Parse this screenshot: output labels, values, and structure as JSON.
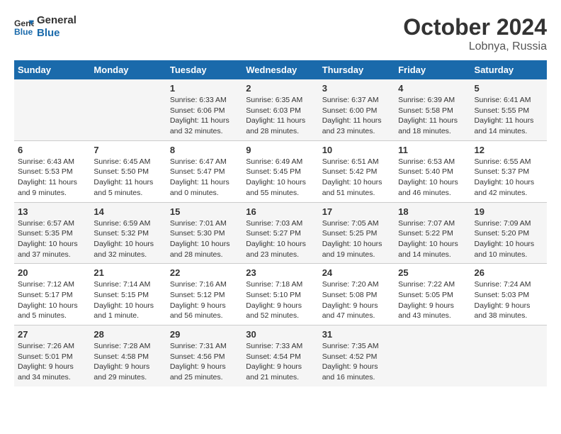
{
  "header": {
    "logo_line1": "General",
    "logo_line2": "Blue",
    "month": "October 2024",
    "location": "Lobnya, Russia"
  },
  "weekdays": [
    "Sunday",
    "Monday",
    "Tuesday",
    "Wednesday",
    "Thursday",
    "Friday",
    "Saturday"
  ],
  "weeks": [
    [
      {
        "day": "",
        "info": ""
      },
      {
        "day": "",
        "info": ""
      },
      {
        "day": "1",
        "info": "Sunrise: 6:33 AM\nSunset: 6:06 PM\nDaylight: 11 hours and 32 minutes."
      },
      {
        "day": "2",
        "info": "Sunrise: 6:35 AM\nSunset: 6:03 PM\nDaylight: 11 hours and 28 minutes."
      },
      {
        "day": "3",
        "info": "Sunrise: 6:37 AM\nSunset: 6:00 PM\nDaylight: 11 hours and 23 minutes."
      },
      {
        "day": "4",
        "info": "Sunrise: 6:39 AM\nSunset: 5:58 PM\nDaylight: 11 hours and 18 minutes."
      },
      {
        "day": "5",
        "info": "Sunrise: 6:41 AM\nSunset: 5:55 PM\nDaylight: 11 hours and 14 minutes."
      }
    ],
    [
      {
        "day": "6",
        "info": "Sunrise: 6:43 AM\nSunset: 5:53 PM\nDaylight: 11 hours and 9 minutes."
      },
      {
        "day": "7",
        "info": "Sunrise: 6:45 AM\nSunset: 5:50 PM\nDaylight: 11 hours and 5 minutes."
      },
      {
        "day": "8",
        "info": "Sunrise: 6:47 AM\nSunset: 5:47 PM\nDaylight: 11 hours and 0 minutes."
      },
      {
        "day": "9",
        "info": "Sunrise: 6:49 AM\nSunset: 5:45 PM\nDaylight: 10 hours and 55 minutes."
      },
      {
        "day": "10",
        "info": "Sunrise: 6:51 AM\nSunset: 5:42 PM\nDaylight: 10 hours and 51 minutes."
      },
      {
        "day": "11",
        "info": "Sunrise: 6:53 AM\nSunset: 5:40 PM\nDaylight: 10 hours and 46 minutes."
      },
      {
        "day": "12",
        "info": "Sunrise: 6:55 AM\nSunset: 5:37 PM\nDaylight: 10 hours and 42 minutes."
      }
    ],
    [
      {
        "day": "13",
        "info": "Sunrise: 6:57 AM\nSunset: 5:35 PM\nDaylight: 10 hours and 37 minutes."
      },
      {
        "day": "14",
        "info": "Sunrise: 6:59 AM\nSunset: 5:32 PM\nDaylight: 10 hours and 32 minutes."
      },
      {
        "day": "15",
        "info": "Sunrise: 7:01 AM\nSunset: 5:30 PM\nDaylight: 10 hours and 28 minutes."
      },
      {
        "day": "16",
        "info": "Sunrise: 7:03 AM\nSunset: 5:27 PM\nDaylight: 10 hours and 23 minutes."
      },
      {
        "day": "17",
        "info": "Sunrise: 7:05 AM\nSunset: 5:25 PM\nDaylight: 10 hours and 19 minutes."
      },
      {
        "day": "18",
        "info": "Sunrise: 7:07 AM\nSunset: 5:22 PM\nDaylight: 10 hours and 14 minutes."
      },
      {
        "day": "19",
        "info": "Sunrise: 7:09 AM\nSunset: 5:20 PM\nDaylight: 10 hours and 10 minutes."
      }
    ],
    [
      {
        "day": "20",
        "info": "Sunrise: 7:12 AM\nSunset: 5:17 PM\nDaylight: 10 hours and 5 minutes."
      },
      {
        "day": "21",
        "info": "Sunrise: 7:14 AM\nSunset: 5:15 PM\nDaylight: 10 hours and 1 minute."
      },
      {
        "day": "22",
        "info": "Sunrise: 7:16 AM\nSunset: 5:12 PM\nDaylight: 9 hours and 56 minutes."
      },
      {
        "day": "23",
        "info": "Sunrise: 7:18 AM\nSunset: 5:10 PM\nDaylight: 9 hours and 52 minutes."
      },
      {
        "day": "24",
        "info": "Sunrise: 7:20 AM\nSunset: 5:08 PM\nDaylight: 9 hours and 47 minutes."
      },
      {
        "day": "25",
        "info": "Sunrise: 7:22 AM\nSunset: 5:05 PM\nDaylight: 9 hours and 43 minutes."
      },
      {
        "day": "26",
        "info": "Sunrise: 7:24 AM\nSunset: 5:03 PM\nDaylight: 9 hours and 38 minutes."
      }
    ],
    [
      {
        "day": "27",
        "info": "Sunrise: 7:26 AM\nSunset: 5:01 PM\nDaylight: 9 hours and 34 minutes."
      },
      {
        "day": "28",
        "info": "Sunrise: 7:28 AM\nSunset: 4:58 PM\nDaylight: 9 hours and 29 minutes."
      },
      {
        "day": "29",
        "info": "Sunrise: 7:31 AM\nSunset: 4:56 PM\nDaylight: 9 hours and 25 minutes."
      },
      {
        "day": "30",
        "info": "Sunrise: 7:33 AM\nSunset: 4:54 PM\nDaylight: 9 hours and 21 minutes."
      },
      {
        "day": "31",
        "info": "Sunrise: 7:35 AM\nSunset: 4:52 PM\nDaylight: 9 hours and 16 minutes."
      },
      {
        "day": "",
        "info": ""
      },
      {
        "day": "",
        "info": ""
      }
    ]
  ]
}
